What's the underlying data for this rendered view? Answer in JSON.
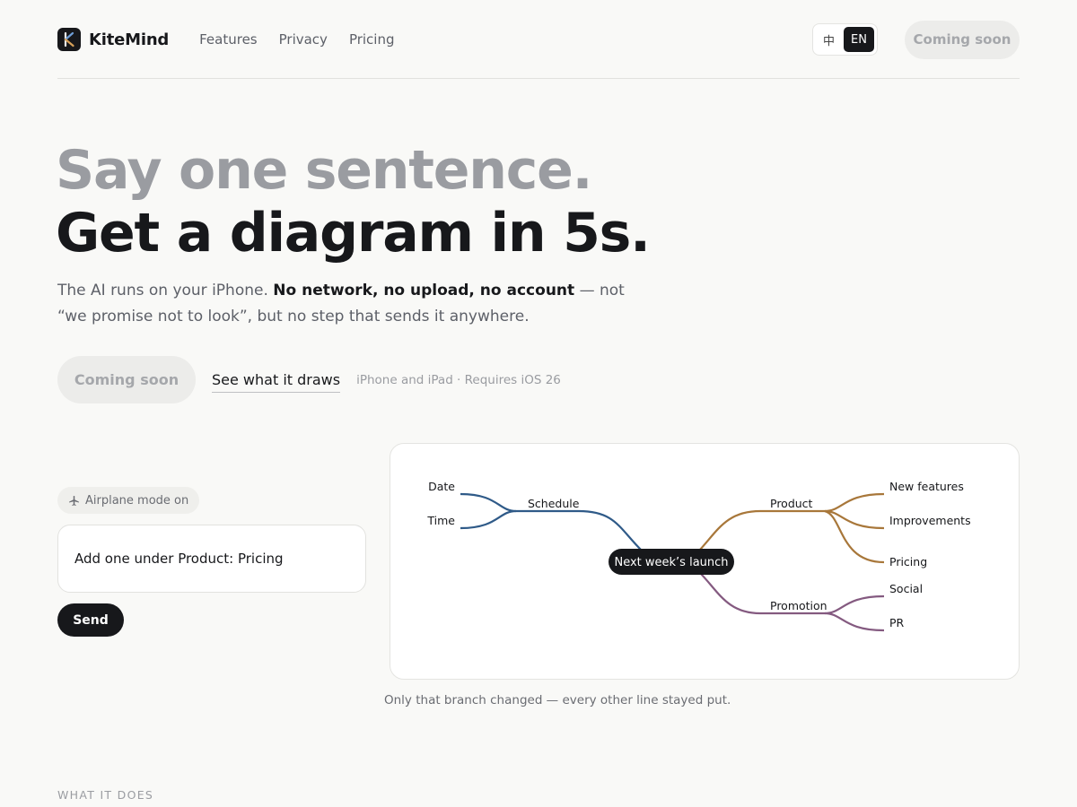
{
  "brand": {
    "name": "KiteMind",
    "logo_letter": "K"
  },
  "nav": {
    "items": [
      "Features",
      "Privacy",
      "Pricing"
    ]
  },
  "lang": {
    "options": [
      "中",
      "EN"
    ],
    "active": "EN"
  },
  "header": {
    "cta_label": "Coming soon"
  },
  "hero": {
    "line1": "Say one sentence.",
    "line2": "Get a diagram in 5s.",
    "sub_intro": "The AI runs on your iPhone.",
    "sub_bold": "No network, no upload, no account",
    "sub_rest": "— not “we promise not to look”, but no step that sends it anywhere.",
    "cta_label": "Coming soon",
    "see_link": "See what it draws",
    "requirement": "iPhone and iPad · Requires iOS 26"
  },
  "chat": {
    "badge": "Airplane mode on",
    "message": "Add one under Product: Pricing",
    "send_label": "Send"
  },
  "diagram": {
    "center": "Next week’s launch",
    "branches": [
      {
        "name": "Schedule",
        "color": "#2f5a88",
        "side": "left",
        "children": [
          "Date",
          "Time"
        ]
      },
      {
        "name": "Product",
        "color": "#a8773a",
        "side": "right",
        "children": [
          "New features",
          "Improvements",
          "Pricing"
        ]
      },
      {
        "name": "Promotion",
        "color": "#845a80",
        "side": "right",
        "children": [
          "Social",
          "PR"
        ]
      }
    ],
    "caption": "Only that branch changed — every other line stayed put."
  },
  "section": {
    "label": "WHAT IT DOES"
  }
}
